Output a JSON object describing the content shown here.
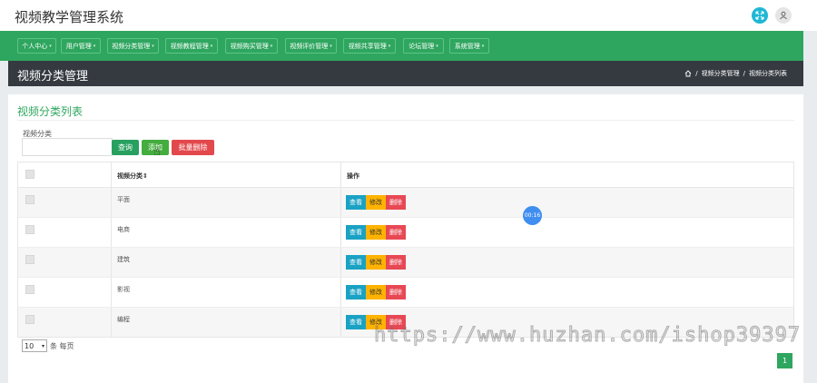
{
  "header": {
    "app_title": "视频教学管理系统"
  },
  "nav": {
    "items": [
      {
        "label": "个人中心"
      },
      {
        "label": "用户管理"
      },
      {
        "label": "视频分类管理"
      },
      {
        "label": "视频教程管理"
      },
      {
        "label": "视频购买管理"
      },
      {
        "label": "视频评价管理"
      },
      {
        "label": "视频共享管理"
      },
      {
        "label": "论坛管理"
      },
      {
        "label": "系统管理"
      }
    ]
  },
  "page": {
    "title": "视频分类管理",
    "breadcrumb": [
      "视频分类管理",
      "视频分类列表"
    ],
    "breadcrumb_sep": "/"
  },
  "card": {
    "title": "视频分类列表",
    "search_label": "视频分类",
    "search_value": "",
    "search_button": "查询",
    "add_button": "添加",
    "batch_delete_button": "批量删除"
  },
  "table": {
    "headers": {
      "name": "视频分类",
      "sort_icon": "⇕",
      "ops": "操作"
    },
    "rows": [
      {
        "name": "平面"
      },
      {
        "name": "电商"
      },
      {
        "name": "建筑"
      },
      {
        "name": "影视"
      },
      {
        "name": "编程"
      }
    ],
    "ops": {
      "view": "查看",
      "edit": "修改",
      "delete": "删除"
    }
  },
  "timer": "00:16",
  "pagination": {
    "page_size": "10",
    "page_size_suffix": "条 每页",
    "current_page": "1"
  },
  "watermark": "https://www.huzhan.com/ishop39397",
  "colors": {
    "accent": "#2fa65f",
    "dark_bar": "#343a40",
    "view": "#1aa2c4",
    "edit": "#ffb300",
    "delete": "#e84854"
  }
}
